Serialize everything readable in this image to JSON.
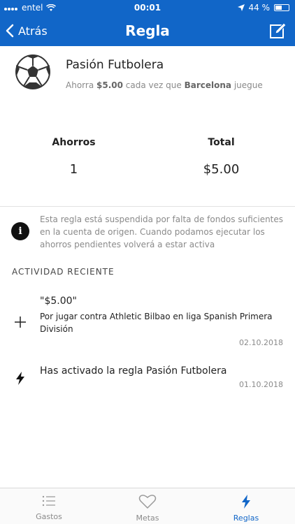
{
  "status_bar": {
    "carrier": "entel",
    "time": "00:01",
    "battery": "44 %"
  },
  "nav": {
    "back_label": "Atrás",
    "title": "Regla"
  },
  "rule": {
    "name": "Pasión Futbolera",
    "desc_prefix": "Ahorra",
    "amount": "$5.00",
    "desc_mid": "cada vez que",
    "team": "Barcelona",
    "desc_suffix": "juegue"
  },
  "stats": {
    "savings_label": "Ahorros",
    "savings_value": "1",
    "total_label": "Total",
    "total_value": "$5.00"
  },
  "notice": {
    "text": "Esta regla está suspendida por falta de fondos suficientes en la cuenta de origen. Cuando podamos ejecutar los ahorros pendientes volverá a estar activa"
  },
  "activity": {
    "section_title": "ACTIVIDAD RECIENTE",
    "items": [
      {
        "icon": "plus-icon",
        "title": "\"$5.00\"",
        "desc": "Por jugar contra Athletic Bilbao en liga Spanish Primera División",
        "date": "02.10.2018"
      },
      {
        "icon": "bolt-icon",
        "title": "Has activado la regla Pasión Futbolera",
        "desc": "",
        "date": "01.10.2018"
      }
    ]
  },
  "tabs": [
    {
      "label": "Gastos",
      "icon": "list-icon",
      "active": false
    },
    {
      "label": "Metas",
      "icon": "heart-icon",
      "active": false
    },
    {
      "label": "Reglas",
      "icon": "bolt-icon",
      "active": true
    }
  ],
  "colors": {
    "brand": "#1166c8",
    "muted": "#8a8a8a",
    "text": "#222222"
  }
}
